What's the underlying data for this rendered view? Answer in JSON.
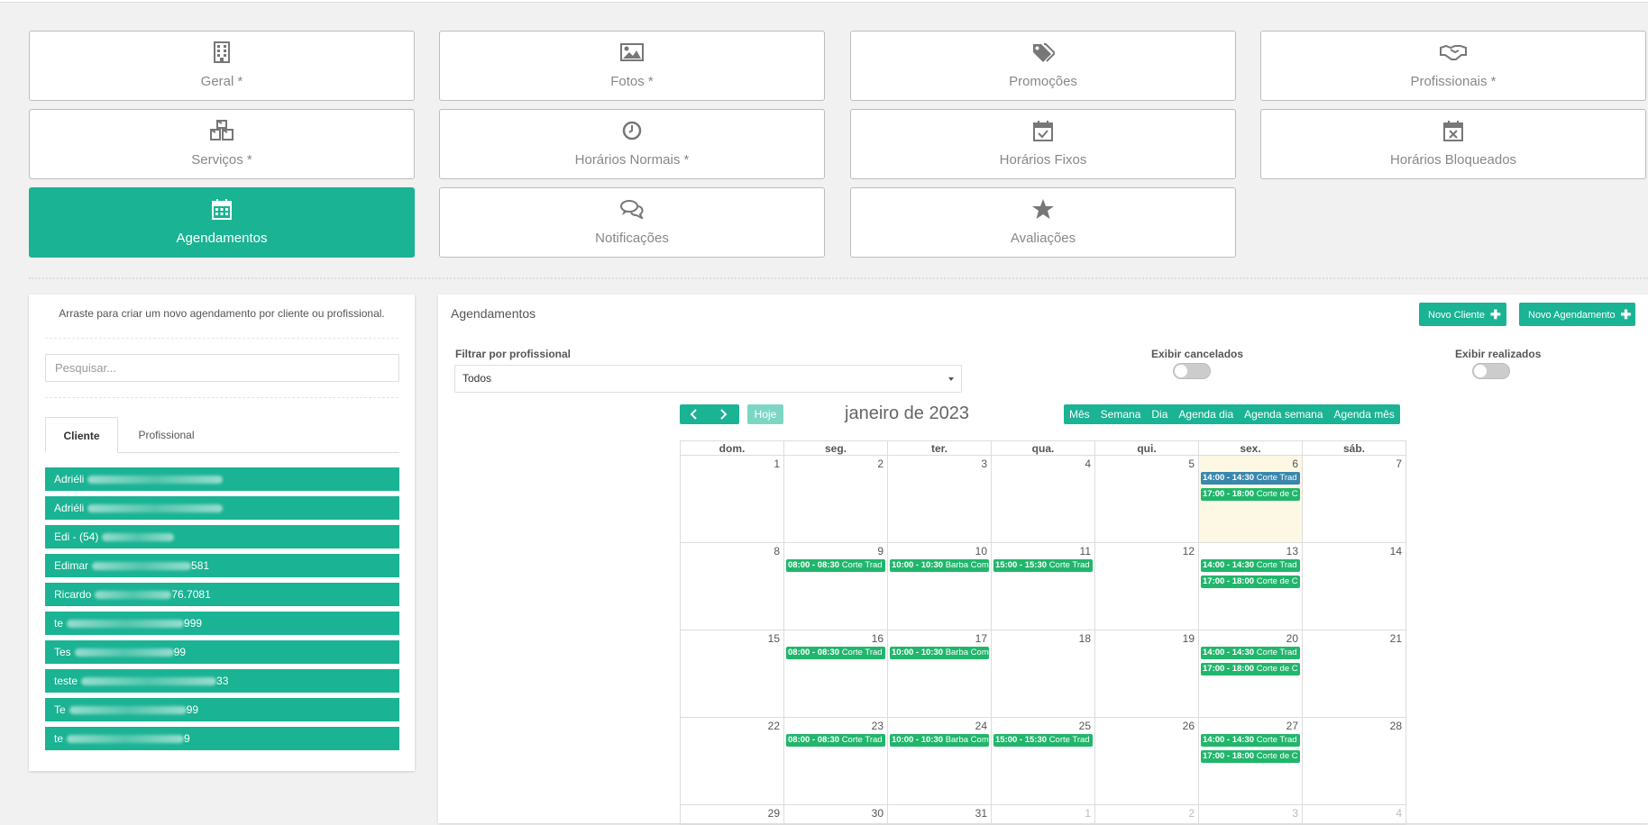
{
  "colors": {
    "accent": "#1ab394",
    "event_blue": "#3a87ad",
    "event_green": "#21b66b",
    "today_bg": "#fcf8e3"
  },
  "tiles": [
    {
      "label": "Geral *",
      "icon": "building-icon"
    },
    {
      "label": "Fotos *",
      "icon": "image-icon"
    },
    {
      "label": "Promoções",
      "icon": "tags-icon"
    },
    {
      "label": "Profissionais *",
      "icon": "handshake-icon"
    },
    {
      "label": "Serviços *",
      "icon": "cubes-icon"
    },
    {
      "label": "Horários Normais *",
      "icon": "clock-icon"
    },
    {
      "label": "Horários Fixos",
      "icon": "calendar-check-icon"
    },
    {
      "label": "Horários Bloqueados",
      "icon": "calendar-times-icon"
    },
    {
      "label": "Agendamentos",
      "icon": "calendar-icon",
      "active": true
    },
    {
      "label": "Notificações",
      "icon": "comments-icon"
    },
    {
      "label": "Avaliações",
      "icon": "star-icon"
    }
  ],
  "left": {
    "hint": "Arraste para criar um novo agendamento por cliente ou profissional.",
    "search_placeholder": "Pesquisar...",
    "tabs": [
      "Cliente",
      "Profissional"
    ],
    "clients": [
      {
        "pre": "Adriéli",
        "post": ""
      },
      {
        "pre": "Adriéli",
        "post": ""
      },
      {
        "pre": "Edi - (54)",
        "post": ""
      },
      {
        "pre": "Edimar",
        "post": "581"
      },
      {
        "pre": "Ricardo",
        "post": "76.7081"
      },
      {
        "pre": "te",
        "post": "999"
      },
      {
        "pre": "Tes",
        "post": "99"
      },
      {
        "pre": "teste",
        "post": "33"
      },
      {
        "pre": "Te",
        "post": "99"
      },
      {
        "pre": "te",
        "post": "9"
      }
    ]
  },
  "main": {
    "title": "Agendamentos",
    "new_client": "Novo Cliente",
    "new_appointment": "Novo Agendamento",
    "filter_label": "Filtrar por profissional",
    "filter_value": "Todos",
    "show_canceled": "Exibir cancelados",
    "show_done": "Exibir realizados",
    "today_btn": "Hoje",
    "calendar_title": "janeiro de 2023",
    "views": [
      "Mês",
      "Semana",
      "Dia",
      "Agenda dia",
      "Agenda semana",
      "Agenda mês"
    ]
  },
  "calendar": {
    "weekdays": [
      "dom.",
      "seg.",
      "ter.",
      "qua.",
      "qui.",
      "sex.",
      "sáb."
    ],
    "weeks": [
      [
        {
          "d": "",
          "o": false
        },
        {
          "d": "",
          "o": false
        },
        {
          "d": "",
          "o": false
        },
        {
          "d": "",
          "o": false
        },
        {
          "d": "",
          "o": false
        },
        {
          "d": "",
          "o": false
        },
        {
          "d": "",
          "o": false
        }
      ]
    ],
    "days": [
      [
        1,
        2,
        3,
        4,
        5,
        6,
        7
      ],
      [
        8,
        9,
        10,
        11,
        12,
        13,
        14
      ],
      [
        15,
        16,
        17,
        18,
        19,
        20,
        21
      ],
      [
        22,
        23,
        24,
        25,
        26,
        27,
        28
      ],
      [
        29,
        30,
        31,
        1,
        2,
        3,
        4
      ]
    ],
    "other_month_from": [
      4,
      3
    ],
    "today": [
      0,
      5
    ],
    "events": [
      {
        "w": 0,
        "c": 5,
        "time": "14:00 - 14:30",
        "title": "Corte Trad",
        "color": "blue"
      },
      {
        "w": 0,
        "c": 5,
        "time": "17:00 - 18:00",
        "title": "Corte de C",
        "color": "green"
      },
      {
        "w": 1,
        "c": 1,
        "time": "08:00 - 08:30",
        "title": "Corte Trad",
        "color": "green"
      },
      {
        "w": 1,
        "c": 2,
        "time": "10:00 - 10:30",
        "title": "Barba Com",
        "color": "green"
      },
      {
        "w": 1,
        "c": 3,
        "time": "15:00 - 15:30",
        "title": "Corte Trad",
        "color": "green"
      },
      {
        "w": 1,
        "c": 5,
        "time": "14:00 - 14:30",
        "title": "Corte Trad",
        "color": "green"
      },
      {
        "w": 1,
        "c": 5,
        "time": "17:00 - 18:00",
        "title": "Corte de C",
        "color": "green"
      },
      {
        "w": 2,
        "c": 1,
        "time": "08:00 - 08:30",
        "title": "Corte Trad",
        "color": "green"
      },
      {
        "w": 2,
        "c": 2,
        "time": "10:00 - 10:30",
        "title": "Barba Com",
        "color": "green"
      },
      {
        "w": 2,
        "c": 5,
        "time": "14:00 - 14:30",
        "title": "Corte Trad",
        "color": "green"
      },
      {
        "w": 2,
        "c": 5,
        "time": "17:00 - 18:00",
        "title": "Corte de C",
        "color": "green"
      },
      {
        "w": 3,
        "c": 1,
        "time": "08:00 - 08:30",
        "title": "Corte Trad",
        "color": "green"
      },
      {
        "w": 3,
        "c": 2,
        "time": "10:00 - 10:30",
        "title": "Barba Com",
        "color": "green"
      },
      {
        "w": 3,
        "c": 3,
        "time": "15:00 - 15:30",
        "title": "Corte Trad",
        "color": "green"
      },
      {
        "w": 3,
        "c": 5,
        "time": "14:00 - 14:30",
        "title": "Corte Trad",
        "color": "green"
      },
      {
        "w": 3,
        "c": 5,
        "time": "17:00 - 18:00",
        "title": "Corte de C",
        "color": "green"
      }
    ]
  }
}
